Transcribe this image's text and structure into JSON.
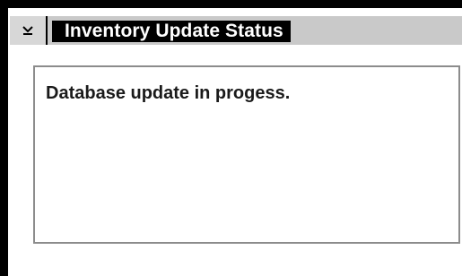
{
  "window": {
    "title": "Inventory Update Status",
    "system_menu_icon": "chevron-down-icon"
  },
  "panel": {
    "message": "Database update in progess."
  },
  "colors": {
    "frame": "#000000",
    "titlebar": "#c9c9c9",
    "panel_border": "#8c8c8c"
  }
}
